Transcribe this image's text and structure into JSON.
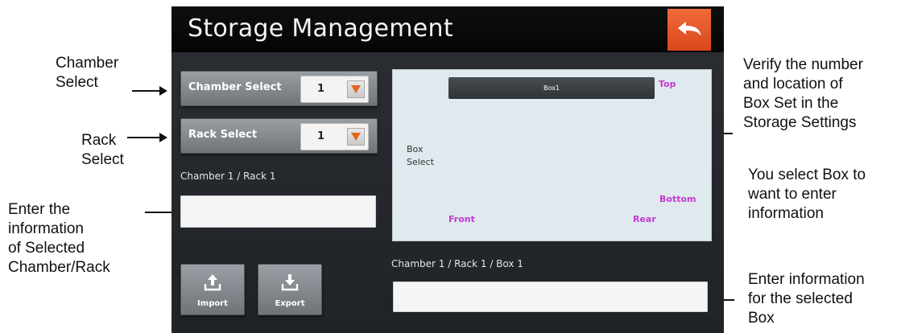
{
  "app": {
    "title": "Storage Management"
  },
  "chamber_select": {
    "label": "Chamber Select",
    "value": "1"
  },
  "rack_select": {
    "label": "Rack Select",
    "value": "1"
  },
  "chamber_rack_path": "Chamber 1 / Rack 1",
  "chamber_rack_input": {
    "value": "",
    "placeholder": ""
  },
  "box_panel": {
    "box_label": "Box1",
    "top": "Top",
    "box_select": "Box\nSelect",
    "bottom": "Bottom",
    "front": "Front",
    "rear": "Rear"
  },
  "box_path": "Chamber 1 / Rack 1 / Box 1",
  "box_input": {
    "value": "",
    "placeholder": ""
  },
  "buttons": {
    "import": "Import",
    "export": "Export"
  },
  "annotations": {
    "chamber_select": "Chamber\nSelect",
    "rack_select": "Rack\nSelect",
    "enter_info_rack": "Enter the\ninformation\nof Selected\nChamber/Rack",
    "verify": "Verify the number\nand location of\nBox Set in the\nStorage Settings",
    "select_box": "You select Box to\nwant to enter\ninformation",
    "enter_info_box": "Enter information\nfor the selected\nBox"
  },
  "colors": {
    "accent_orange": "#e2651f",
    "back_button": "#e8562a",
    "panel_bg": "#dfe9ee",
    "label_magenta": "#c23ad1",
    "screen_bg": "#2b2f33"
  },
  "icons": [
    "back-arrow-icon",
    "dropdown-arrow-icon",
    "upload-icon",
    "download-icon"
  ]
}
